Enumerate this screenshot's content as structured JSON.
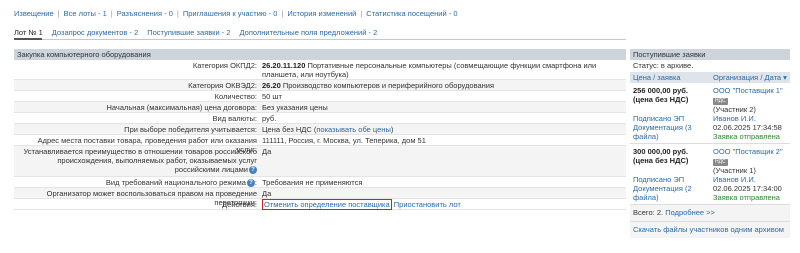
{
  "top_nav": [
    "Извещение",
    "Все лоты - 1",
    "Разъяснения - 0",
    "Приглашения к участию - 0",
    "История изменений",
    "Статистика посещений - 0"
  ],
  "sub_tabs": [
    "Лот № 1",
    "Дозапрос документов - 2",
    "Поступившие заявки - 2",
    "Дополнительные поля предложений - 2"
  ],
  "main": {
    "header": "Закупка компьютерного оборудования",
    "rows": {
      "okpd2_label": "Категория ОКПД2:",
      "okpd2_code": "26.20.11.120",
      "okpd2_text": "Портативные персональные компьютеры (совмещающие функции смартфона или планшета, или ноутбука)",
      "okved2_label": "Категория ОКВЭД2:",
      "okved2_code": "26.20",
      "okved2_text": "Производство компьютеров и периферийного оборудования",
      "qty_label": "Количество:",
      "qty_value": "50 шт",
      "price_label": "Начальная (максимальная) цена договора:",
      "price_value": "Без указания цены",
      "currency_label": "Вид валюты:",
      "currency_value": "руб.",
      "winner_label": "При выборе победителя учитывается:",
      "winner_value": "Цена без НДС (",
      "winner_link": "показывать обе цены",
      "winner_close": ")",
      "address_label": "Адрес места поставки товара, проведения работ или оказания услуг:",
      "address_value": "111111, Россия, г. Москва, ул. Теперика, дом 51",
      "priority_label": "Устанавливается преимущество в отношении товаров российского происхождения, выполняемых работ, оказываемых услуг российскими лицами",
      "priority_value": "Да",
      "national_label": "Вид требований национального режима",
      "national_value": "Требования не применяются",
      "rebid_label": "Организатор может воспользоваться правом на проведение переторжки:",
      "rebid_value": "Да",
      "actions_label": "Действия:",
      "action_cancel": "Отменить определение поставщика",
      "action_pause": "Приостановить лот"
    }
  },
  "side": {
    "header": "Поступившие заявки",
    "status": "Статус: в архиве.",
    "col1": "Цена / заявка",
    "col2": "Организация / Дата ▾",
    "bids": [
      {
        "price": "256 000,00 руб. (цена без НДС)",
        "signed": "Подписано ЭП",
        "docs": "Документация (3 файла)",
        "org": "ООО \"Поставщик 1\"",
        "badge": "НДС",
        "place": "(Участник 2)",
        "person": "Иванов И.И.",
        "date": "02.06.2025 17:34:58",
        "state": "Заявка отправлена"
      },
      {
        "price": "300 000,00 руб. (цена без НДС)",
        "signed": "Подписано ЭП",
        "docs": "Документация (2 файла)",
        "org": "ООО \"Поставщик 2\"",
        "badge": "НДС",
        "place": "(Участник 1)",
        "person": "Иванов И.И.",
        "date": "02.06.2025 17:34:00",
        "state": "Заявка отправлена"
      }
    ],
    "total": "Всего: 2.",
    "more": "Подробнее >>",
    "download": "Скачать файлы участников одним архивом"
  },
  "colors": {
    "link": "#2a6aa8",
    "header_bg": "#cdd4dc",
    "highlight": "#d02020",
    "ok": "#2a8a2a"
  }
}
